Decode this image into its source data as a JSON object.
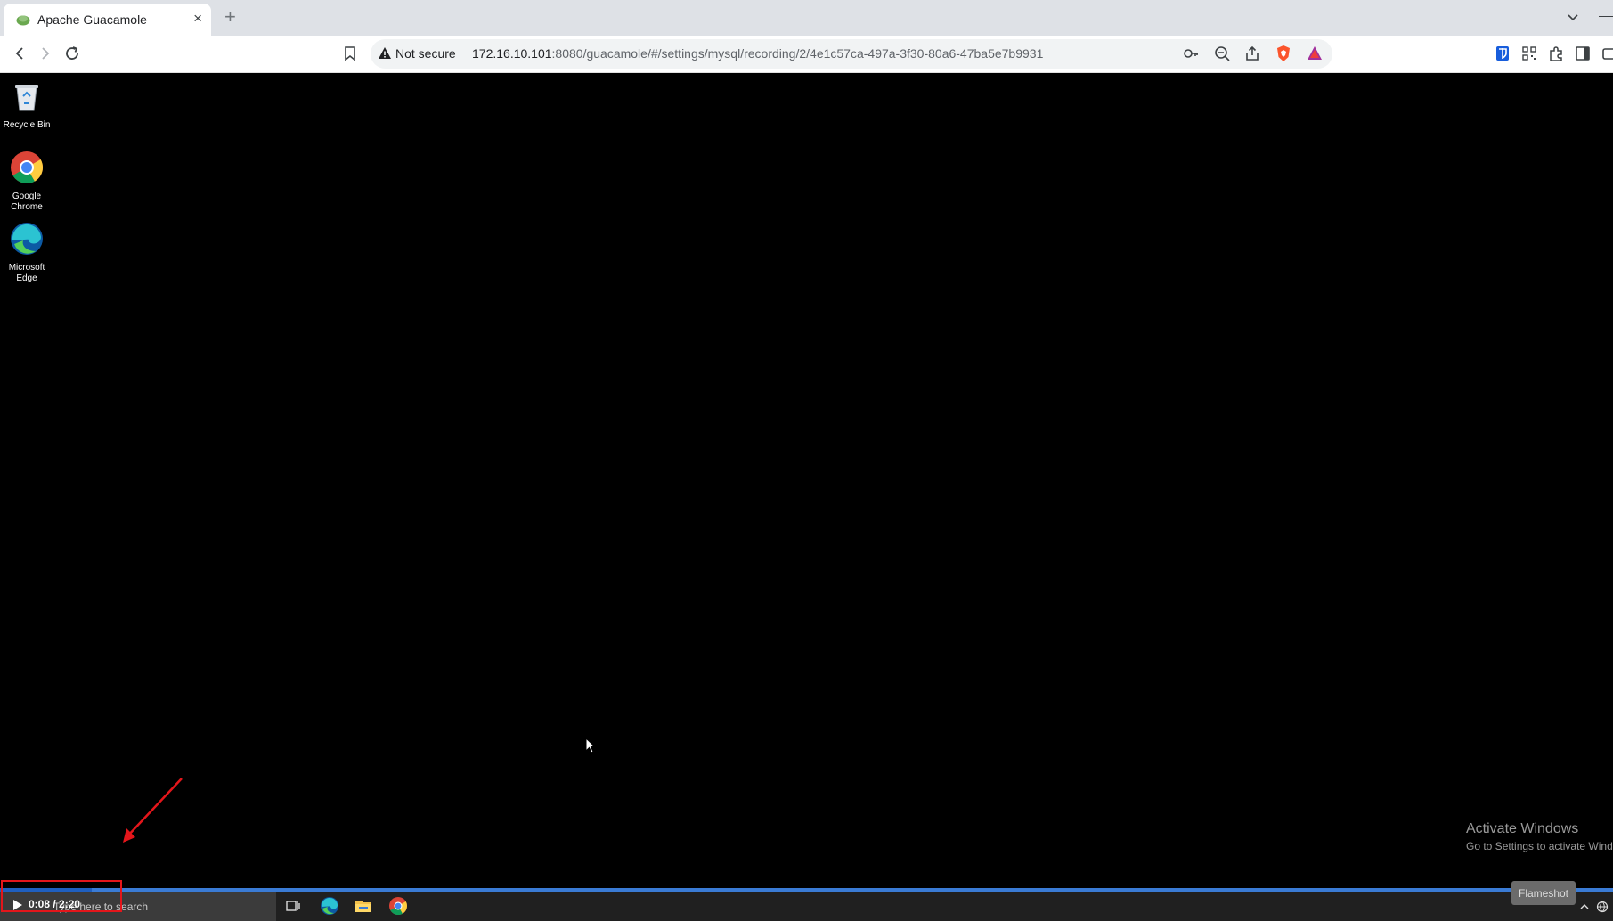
{
  "browser": {
    "tab": {
      "title": "Apache Guacamole",
      "close": "×"
    },
    "new_tab": "+",
    "address": {
      "security_label": "Not secure",
      "host": "172.16.10.101",
      "path": ":8080/guacamole/#/settings/mysql/recording/2/4e1c57ca-497a-3f30-80a6-47ba5e7b9931"
    },
    "icons": [
      "back-icon",
      "forward-icon",
      "reload-icon",
      "bookmark-icon",
      "key-icon",
      "zoom-out-icon",
      "share-icon",
      "brave-shields-icon",
      "brave-rewards-icon",
      "bitwarden-icon",
      "qr-icon",
      "extensions-icon",
      "sidebar-icon"
    ]
  },
  "desktop": {
    "icons": [
      {
        "label": "Recycle Bin",
        "icon": "recycle-bin-icon"
      },
      {
        "label": "Google Chrome",
        "icon": "chrome-icon"
      },
      {
        "label": "Microsoft Edge",
        "icon": "edge-icon"
      }
    ],
    "activation": {
      "title": "Activate Windows",
      "subtitle": "Go to Settings to activate Windo"
    }
  },
  "taskbar": {
    "search_placeholder": "Type here to search",
    "apps": [
      "task-view-icon",
      "edge-icon",
      "file-explorer-icon",
      "chrome-icon"
    ]
  },
  "player": {
    "time": "0:08 / 2:20",
    "progress_fraction": 0.057,
    "flameshot_label": "Flameshot"
  },
  "colors": {
    "annotation": "#e4161b",
    "progress": "#3a7bd5"
  }
}
